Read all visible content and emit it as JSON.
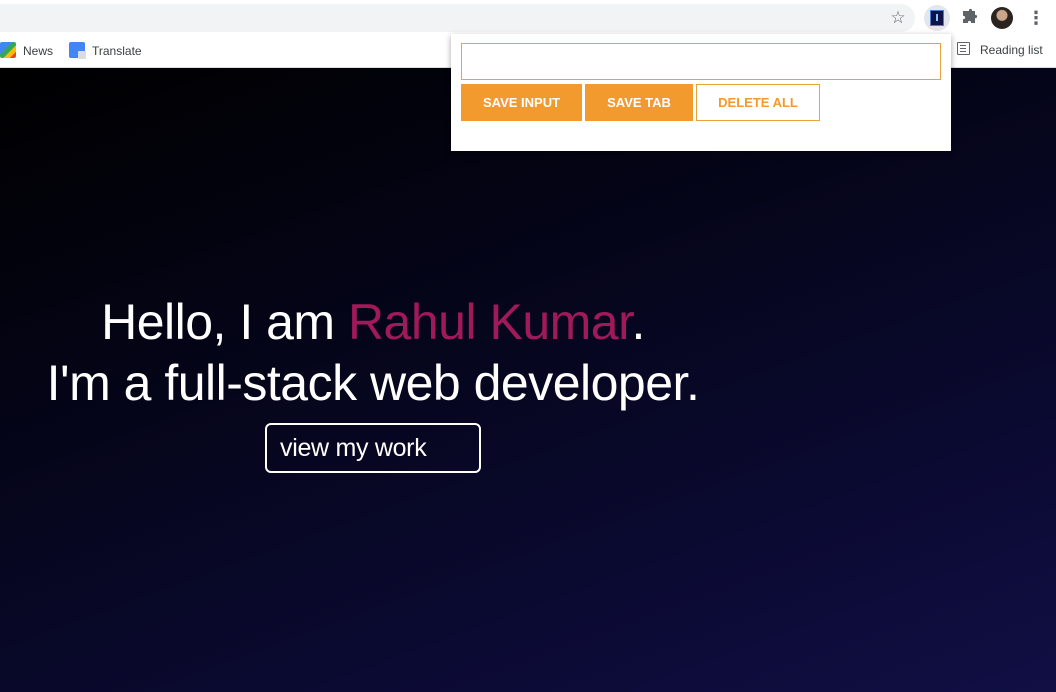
{
  "browser": {
    "bookmarks": [
      {
        "label": "News",
        "icon": "google-news-icon"
      },
      {
        "label": "Translate",
        "icon": "google-translate-icon"
      }
    ],
    "reading_list_label": "Reading list",
    "icons": [
      "star-icon",
      "extension-active-icon",
      "puzzle-icon",
      "profile-avatar",
      "kebab-menu-icon",
      "reading-list-icon"
    ]
  },
  "popup": {
    "input_value": "",
    "save_input_label": "SAVE INPUT",
    "save_tab_label": "SAVE TAB",
    "delete_all_label": "DELETE ALL",
    "accent_color": "#f29a2e"
  },
  "page": {
    "greeting_prefix": "Hello, I am ",
    "name": "Rahul Kumar",
    "greeting_suffix": ".",
    "tagline": "I'm a full-stack web developer.",
    "cta_label": "view my work",
    "name_color": "#a01a5a"
  }
}
